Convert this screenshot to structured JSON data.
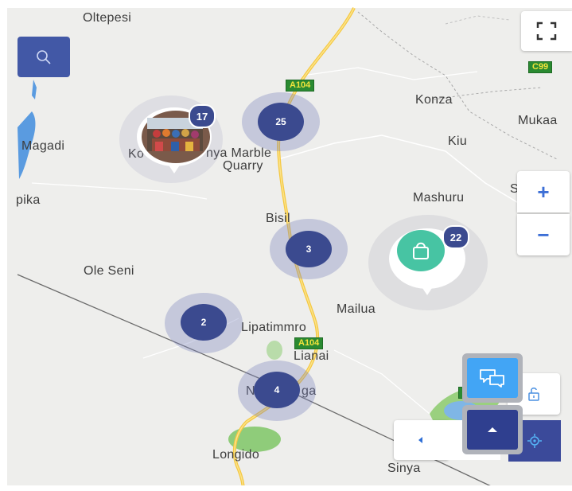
{
  "map": {
    "places": {
      "oltepesi": "Oltepesi",
      "magadi": "Magadi",
      "kora_partial": "Ko",
      "marble_line1": "nya Marble",
      "marble_line2": "Quarry",
      "konza": "Konza",
      "mukaa": "Mukaa",
      "kiu": "Kiu",
      "mashuru": "Mashuru",
      "edge_s": "S",
      "pika": "pika",
      "bisil": "Bisil",
      "ole_seni": "Ole Seni",
      "mailua": "Mailua",
      "lipatimmro": "Lipatimmro",
      "lianai": "Lianai",
      "namanga_partial_left": "N",
      "namanga_partial_right": "ga",
      "longido": "Longido",
      "sinya": "Sinya",
      "partial_g": "G"
    },
    "road_shields": {
      "a104_top": "A104",
      "a104_mid": "A104",
      "c99": "C99"
    }
  },
  "clusters": [
    {
      "count": "25"
    },
    {
      "count": "3"
    },
    {
      "count": "2"
    },
    {
      "count": "4"
    }
  ],
  "photo_marker": {
    "badge": "17"
  },
  "shop_marker": {
    "badge": "22",
    "color": "#47c4a3"
  },
  "controls": {
    "zoom_in": "+",
    "zoom_out": "−"
  },
  "colors": {
    "cluster": "#3b4a8f",
    "road": "#f5c842",
    "water": "#5a9be0",
    "search_button": "#4258a6",
    "chat_button": "#42a5f5"
  }
}
